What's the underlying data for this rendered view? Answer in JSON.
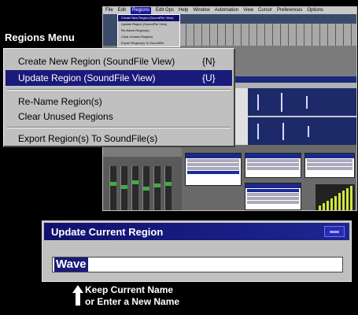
{
  "app": {
    "menubar": [
      "File",
      "Edit",
      "Regions",
      "Edit Ops",
      "Help",
      "Window",
      "Automation",
      "View",
      "Cursor",
      "Preferences",
      "Options",
      "Help"
    ],
    "mini_menu": [
      "Create New Region (SoundFile View)",
      "Update Region (SoundFile View)",
      "Re-Name Region(s)",
      "Clear Unused Regions",
      "Export Region(s) To SoundFile"
    ]
  },
  "heading": "Regions Menu",
  "regions_menu": {
    "items": [
      {
        "label": "Create New Region  (SoundFile View)",
        "shortcut": "{N}"
      },
      {
        "label": "Update Region  (SoundFile View)",
        "shortcut": "{U}"
      },
      {
        "label": "Re-Name Region(s)",
        "shortcut": ""
      },
      {
        "label": "Clear Unused Regions",
        "shortcut": ""
      },
      {
        "label": "Export Region(s) To SoundFile(s)",
        "shortcut": ""
      }
    ],
    "highlighted_index": 1
  },
  "dialog": {
    "title": "Update Current Region",
    "input_value": "Wave"
  },
  "hint": {
    "line1": "Keep Current Name",
    "line2": "or Enter a New Name"
  },
  "colors": {
    "highlight": "#1a1a7a",
    "titlebar": "#10106e",
    "menu_bg": "#c0c0c0"
  }
}
